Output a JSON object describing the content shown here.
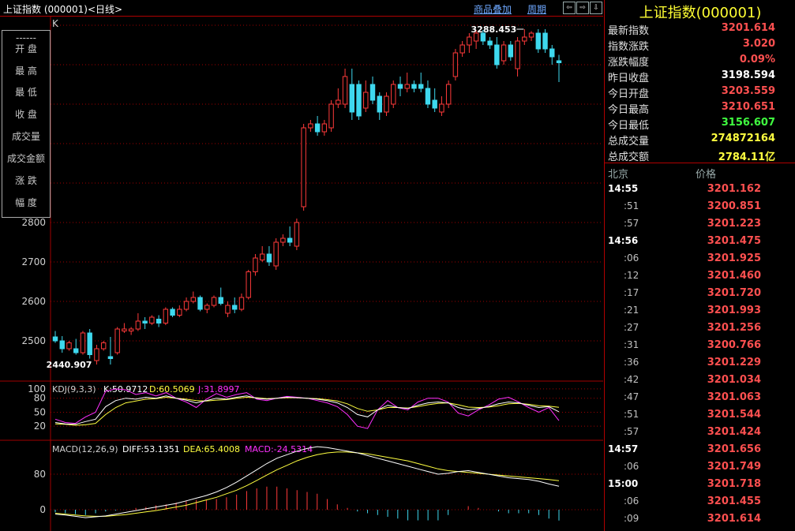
{
  "title": "上证指数 (000001)<日线>",
  "toolbar": {
    "overlay_label": "商品叠加",
    "period_label": "周期",
    "nav_buttons": [
      "⇦",
      "⇨",
      "⇩"
    ]
  },
  "k_label": "K",
  "info_labels": [
    "------",
    "开  盘",
    "最  高",
    "最  低",
    "收  盘",
    "成交量",
    "成交金额",
    "涨  跌",
    "幅  度"
  ],
  "y_axis_labels": [
    "2800",
    "2700",
    "2600",
    "2500"
  ],
  "annotations": {
    "high": "3288.453",
    "low": "2440.907"
  },
  "kdj": {
    "label": "KDJ(9,3,3)",
    "k": "K:50.9712",
    "d": "D:60.5069",
    "j": "J:31.8997",
    "ticks": [
      "100",
      "80",
      "50",
      "20"
    ]
  },
  "macd": {
    "label": "MACD(12,26,9)",
    "diff": "DIFF:53.1351",
    "dea": "DEA:65.4008",
    "macd": "MACD:-24.5314",
    "ticks": [
      "80",
      "0"
    ]
  },
  "colors": {
    "up": "#ff3a3a",
    "down": "#3ed8ee",
    "k": "#ffffff",
    "d": "#ffff40",
    "j": "#ff30ff",
    "grid": "#a00000"
  },
  "right_panel": {
    "title": "上证指数(000001)",
    "rows": [
      {
        "label": "最新指数",
        "value": "3201.614",
        "color": "#ff5050"
      },
      {
        "label": "指数涨跌",
        "value": "3.020",
        "color": "#ff5050"
      },
      {
        "label": "涨跌幅度",
        "value": "0.09%",
        "color": "#ff5050"
      },
      {
        "label": "昨日收盘",
        "value": "3198.594",
        "color": "#ffffff"
      },
      {
        "label": "今日开盘",
        "value": "3203.559",
        "color": "#ff5050"
      },
      {
        "label": "今日最高",
        "value": "3210.651",
        "color": "#ff5050"
      },
      {
        "label": "今日最低",
        "value": "3156.607",
        "color": "#40ff40"
      },
      {
        "label": "总成交量",
        "value": "274872164",
        "color": "#ffff40"
      },
      {
        "label": "总成交额",
        "value": "2784.11亿",
        "color": "#ffff40"
      }
    ],
    "tick_header": {
      "time": "北京",
      "price": "价格"
    },
    "ticks": [
      {
        "time": "14:55",
        "price": "3201.162",
        "major": true
      },
      {
        "time": ":51",
        "price": "3200.851",
        "major": false
      },
      {
        "time": ":57",
        "price": "3201.223",
        "major": false
      },
      {
        "time": "14:56",
        "price": "3201.475",
        "major": true
      },
      {
        "time": ":06",
        "price": "3201.925",
        "major": false
      },
      {
        "time": ":12",
        "price": "3201.460",
        "major": false
      },
      {
        "time": ":17",
        "price": "3201.720",
        "major": false
      },
      {
        "time": ":21",
        "price": "3201.993",
        "major": false
      },
      {
        "time": ":27",
        "price": "3201.256",
        "major": false
      },
      {
        "time": ":31",
        "price": "3200.766",
        "major": false
      },
      {
        "time": ":36",
        "price": "3201.229",
        "major": false
      },
      {
        "time": ":42",
        "price": "3201.034",
        "major": false
      },
      {
        "time": ":47",
        "price": "3201.063",
        "major": false
      },
      {
        "time": ":51",
        "price": "3201.544",
        "major": false
      },
      {
        "time": ":57",
        "price": "3201.424",
        "major": false
      },
      {
        "time": "14:57",
        "price": "3201.656",
        "major": true
      },
      {
        "time": ":06",
        "price": "3201.749",
        "major": false
      },
      {
        "time": "15:00",
        "price": "3201.718",
        "major": true
      },
      {
        "time": ":06",
        "price": "3201.455",
        "major": false
      },
      {
        "time": ":09",
        "price": "3201.614",
        "major": false
      }
    ]
  },
  "chart_data": {
    "type": "candlestick",
    "candles": [
      [
        2510,
        2525,
        2495,
        2500
      ],
      [
        2500,
        2512,
        2470,
        2480
      ],
      [
        2480,
        2500,
        2475,
        2495
      ],
      [
        2480,
        2505,
        2465,
        2470
      ],
      [
        2470,
        2525,
        2465,
        2520
      ],
      [
        2520,
        2530,
        2455,
        2465
      ],
      [
        2450,
        2490,
        2440,
        2480
      ],
      [
        2480,
        2500,
        2475,
        2495
      ],
      [
        2460,
        2510,
        2440,
        2455
      ],
      [
        2470,
        2535,
        2465,
        2530
      ],
      [
        2525,
        2545,
        2520,
        2530
      ],
      [
        2525,
        2535,
        2515,
        2530
      ],
      [
        2530,
        2570,
        2525,
        2550
      ],
      [
        2550,
        2560,
        2530,
        2545
      ],
      [
        2545,
        2565,
        2540,
        2560
      ],
      [
        2555,
        2565,
        2535,
        2545
      ],
      [
        2545,
        2585,
        2540,
        2580
      ],
      [
        2580,
        2585,
        2560,
        2565
      ],
      [
        2565,
        2590,
        2560,
        2580
      ],
      [
        2580,
        2610,
        2575,
        2600
      ],
      [
        2600,
        2625,
        2595,
        2610
      ],
      [
        2610,
        2615,
        2575,
        2580
      ],
      [
        2580,
        2595,
        2570,
        2590
      ],
      [
        2590,
        2615,
        2585,
        2610
      ],
      [
        2610,
        2635,
        2590,
        2595
      ],
      [
        2570,
        2600,
        2560,
        2590
      ],
      [
        2590,
        2610,
        2570,
        2580
      ],
      [
        2580,
        2620,
        2575,
        2610
      ],
      [
        2610,
        2680,
        2605,
        2675
      ],
      [
        2675,
        2720,
        2665,
        2710
      ],
      [
        2705,
        2740,
        2700,
        2720
      ],
      [
        2720,
        2740,
        2690,
        2700
      ],
      [
        2690,
        2760,
        2680,
        2750
      ],
      [
        2750,
        2770,
        2740,
        2760
      ],
      [
        2760,
        2790,
        2740,
        2750
      ],
      [
        2740,
        2810,
        2730,
        2800
      ],
      [
        2840,
        3050,
        2830,
        3040
      ],
      [
        3040,
        3060,
        3030,
        3050
      ],
      [
        3050,
        3070,
        3020,
        3030
      ],
      [
        3030,
        3060,
        3020,
        3050
      ],
      [
        3040,
        3110,
        3030,
        3100
      ],
      [
        3100,
        3140,
        3090,
        3110
      ],
      [
        3100,
        3190,
        3090,
        3170
      ],
      [
        3150,
        3190,
        3060,
        3080
      ],
      [
        3150,
        3160,
        3060,
        3070
      ],
      [
        3090,
        3160,
        3080,
        3130
      ],
      [
        3150,
        3170,
        3100,
        3110
      ],
      [
        3120,
        3130,
        3060,
        3080
      ],
      [
        3080,
        3130,
        3070,
        3120
      ],
      [
        3100,
        3160,
        3090,
        3150
      ],
      [
        3150,
        3170,
        3120,
        3140
      ],
      [
        3140,
        3180,
        3130,
        3150
      ],
      [
        3150,
        3160,
        3130,
        3140
      ],
      [
        3150,
        3180,
        3130,
        3140
      ],
      [
        3140,
        3160,
        3090,
        3100
      ],
      [
        3110,
        3140,
        3080,
        3090
      ],
      [
        3080,
        3120,
        3070,
        3100
      ],
      [
        3100,
        3160,
        3090,
        3150
      ],
      [
        3170,
        3240,
        3160,
        3230
      ],
      [
        3230,
        3260,
        3220,
        3250
      ],
      [
        3250,
        3280,
        3230,
        3270
      ],
      [
        3260,
        3288,
        3240,
        3280
      ],
      [
        3280,
        3288,
        3250,
        3260
      ],
      [
        3260,
        3270,
        3240,
        3250
      ],
      [
        3250,
        3270,
        3190,
        3200
      ],
      [
        3210,
        3260,
        3200,
        3250
      ],
      [
        3250,
        3260,
        3210,
        3220
      ],
      [
        3190,
        3270,
        3170,
        3260
      ],
      [
        3260,
        3290,
        3250,
        3270
      ],
      [
        3270,
        3285,
        3260,
        3280
      ],
      [
        3280,
        3290,
        3230,
        3240
      ],
      [
        3280,
        3290,
        3230,
        3240
      ],
      [
        3240,
        3250,
        3200,
        3220
      ],
      [
        3210,
        3225,
        3156,
        3205
      ]
    ],
    "ylabel_ticks": [
      2500,
      2600,
      2700,
      2800
    ],
    "kdj": {
      "k": [
        28,
        25,
        24,
        30,
        35,
        62,
        75,
        80,
        78,
        82,
        80,
        85,
        80,
        76,
        70,
        75,
        80,
        78,
        82,
        85,
        80,
        78,
        80,
        82,
        81,
        80,
        78,
        75,
        70,
        60,
        45,
        40,
        55,
        65,
        60,
        58,
        65,
        70,
        72,
        70,
        60,
        55,
        58,
        62,
        68,
        72,
        70,
        65,
        60,
        62,
        51
      ],
      "d": [
        25,
        24,
        22,
        23,
        26,
        45,
        60,
        70,
        74,
        78,
        79,
        82,
        80,
        78,
        75,
        74,
        76,
        77,
        80,
        82,
        81,
        79,
        80,
        81,
        81,
        80,
        79,
        77,
        74,
        68,
        58,
        52,
        55,
        60,
        60,
        59,
        62,
        66,
        69,
        70,
        66,
        61,
        60,
        61,
        64,
        68,
        69,
        67,
        64,
        63,
        60.5
      ],
      "j": [
        35,
        28,
        26,
        40,
        50,
        95,
        100,
        98,
        88,
        92,
        85,
        92,
        80,
        72,
        60,
        78,
        90,
        82,
        88,
        92,
        78,
        75,
        80,
        84,
        82,
        80,
        75,
        70,
        62,
        45,
        20,
        15,
        55,
        75,
        60,
        55,
        72,
        80,
        80,
        72,
        48,
        42,
        55,
        65,
        78,
        82,
        72,
        60,
        50,
        60,
        32
      ]
    },
    "macd": {
      "diff": [
        -10,
        -12,
        -15,
        -18,
        -16,
        -14,
        -10,
        -6,
        -2,
        2,
        6,
        10,
        14,
        20,
        26,
        32,
        40,
        50,
        62,
        76,
        90,
        104,
        116,
        124,
        132,
        138,
        142,
        140,
        136,
        132,
        128,
        122,
        116,
        110,
        104,
        98,
        92,
        86,
        80,
        82,
        86,
        88,
        84,
        80,
        76,
        72,
        70,
        68,
        64,
        58,
        53
      ],
      "dea": [
        -8,
        -10,
        -12,
        -14,
        -15,
        -15,
        -13,
        -11,
        -8,
        -5,
        -2,
        2,
        6,
        10,
        16,
        22,
        28,
        36,
        44,
        54,
        66,
        78,
        90,
        100,
        110,
        118,
        124,
        128,
        130,
        130,
        128,
        126,
        122,
        118,
        114,
        110,
        104,
        98,
        92,
        88,
        86,
        84,
        82,
        80,
        78,
        76,
        74,
        72,
        70,
        68,
        65.4
      ],
      "hist": [
        -6,
        -8,
        -10,
        -12,
        -8,
        -4,
        -2,
        0,
        4,
        6,
        10,
        12,
        16,
        20,
        22,
        22,
        24,
        28,
        34,
        42,
        48,
        52,
        52,
        48,
        44,
        40,
        36,
        24,
        12,
        4,
        -4,
        -8,
        -12,
        -16,
        -20,
        -24,
        -24,
        -24,
        -24,
        -12,
        0,
        8,
        4,
        0,
        -4,
        -8,
        -8,
        -8,
        -12,
        -20,
        -24.5
      ]
    }
  }
}
